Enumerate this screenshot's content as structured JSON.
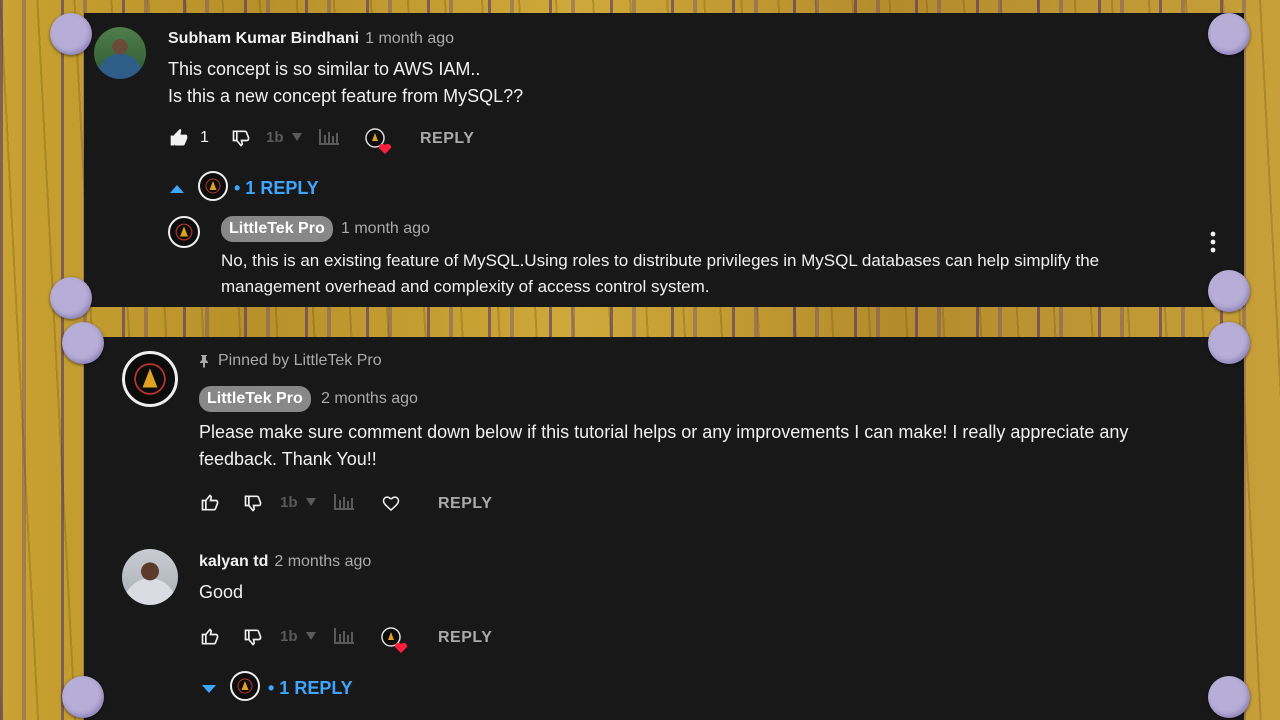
{
  "comment_1": {
    "author": "Subham Kumar Bindhani",
    "time": "1 month ago",
    "text_line1": "This concept is so similar to AWS IAM..",
    "text_line2": "Is this a new concept feature from MySQL??",
    "like_count": "1",
    "reply_label": "REPLY",
    "replies_toggle": "• 1 REPLY",
    "reply": {
      "author": "LittleTek Pro",
      "time": "1 month ago",
      "text_line1": "No, this is an existing feature of MySQL.Using roles to distribute privileges in MySQL databases can help simplify the",
      "text_line2": "management overhead and complexity of access control system."
    }
  },
  "comment_2": {
    "pinned_text": "Pinned by LittleTek Pro",
    "author": "LittleTek Pro",
    "time": "2 months ago",
    "text_line1": "Please make sure comment down below if this tutorial helps or any improvements I can make! I really appreciate any",
    "text_line2": "feedback. Thank You!!",
    "reply_label": "REPLY"
  },
  "comment_3": {
    "author": "kalyan td",
    "time": "2 months ago",
    "text": "Good",
    "reply_label": "REPLY",
    "replies_toggle": "• 1 REPLY"
  },
  "colors": {
    "panel_bg": "#181818",
    "link_blue": "#3ea6ff",
    "muted": "#aaaaaa",
    "heart_red": "#ff1f3d",
    "pin_lavender": "#b6aed6"
  }
}
